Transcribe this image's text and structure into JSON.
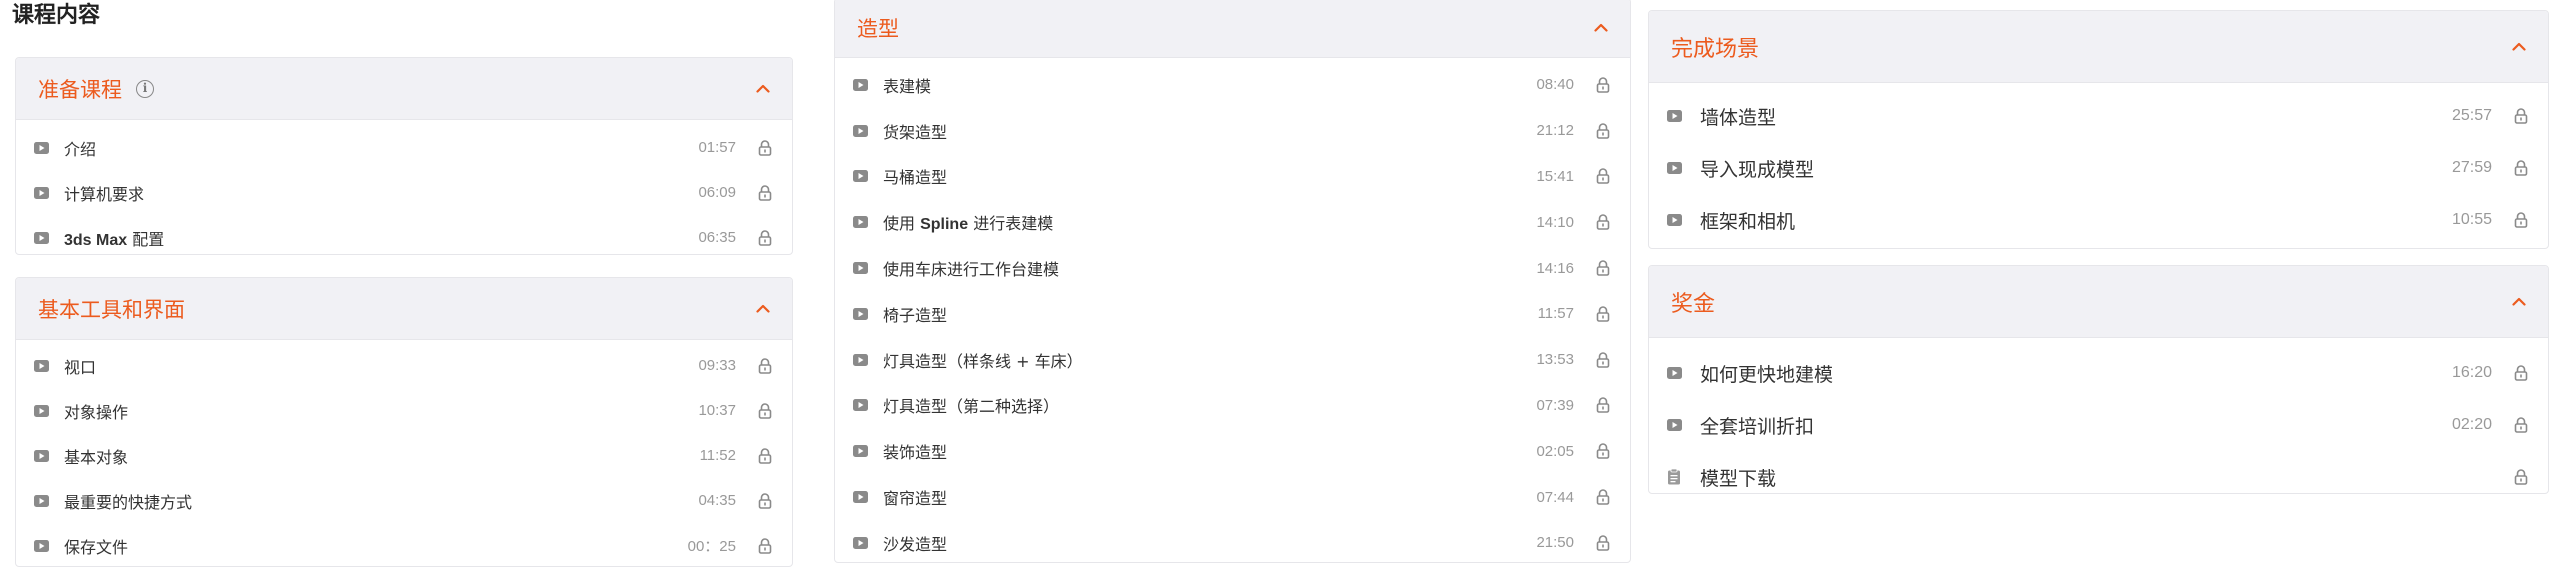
{
  "page_title": "课程内容",
  "columns": [
    {
      "sections": [
        {
          "title": "准备课程",
          "has_info": true,
          "info_glyph": "i",
          "items": [
            {
              "icon": "play-icon",
              "label": "介绍",
              "time": "01:57"
            },
            {
              "icon": "play-icon",
              "label_bold": "3ds Max",
              "label": " 配置",
              "time": "06:35",
              "skip": true
            },
            {
              "icon": "play-icon",
              "label": "计算机要求",
              "time": "06:09"
            }
          ]
        }
      ]
    }
  ],
  "col1": {
    "s1": {
      "title": "准备课程",
      "info_glyph": "i",
      "items": [
        {
          "label": "介绍",
          "time": "01:57"
        },
        {
          "label": "计算机要求",
          "time": "06:09"
        },
        {
          "label_bold": "3ds Max",
          "label": " 配置",
          "time": "06:35"
        }
      ]
    },
    "s2": {
      "title": "基本工具和界面",
      "items": [
        {
          "label": "视口",
          "time": "09:33"
        },
        {
          "label": "对象操作",
          "time": "10:37"
        },
        {
          "label": "基本对象",
          "time": "11:52"
        },
        {
          "label": "最重要的快捷方式",
          "time": "04:35"
        },
        {
          "label": "保存文件",
          "time": "00：25"
        }
      ]
    }
  },
  "col2": {
    "s1": {
      "title": "造型",
      "items": [
        {
          "pre": "表建模",
          "bold": "",
          "post": "",
          "time": "08:40"
        },
        {
          "pre": "货架造型",
          "bold": "",
          "post": "",
          "time": "21:12"
        },
        {
          "pre": "马桶造型",
          "bold": "",
          "post": "",
          "time": "15:41"
        },
        {
          "pre": "使用 ",
          "bold": "Spline",
          "post": " 进行表建模",
          "time": "14:10"
        },
        {
          "pre": "使用车床进行工作台建模",
          "bold": "",
          "post": "",
          "time": "14:16"
        },
        {
          "pre": "椅子造型",
          "bold": "",
          "post": "",
          "time": "11:57"
        },
        {
          "pre": "灯具造型（样条线 + 车床）",
          "bold": "",
          "post": "",
          "time": "13:53"
        },
        {
          "pre": "灯具造型（第二种选择）",
          "bold": "",
          "post": "",
          "time": "07:39"
        },
        {
          "pre": "装饰造型",
          "bold": "",
          "post": "",
          "time": "02:05"
        },
        {
          "pre": "窗帘造型",
          "bold": "",
          "post": "",
          "time": "07:44"
        },
        {
          "pre": "沙发造型",
          "bold": "",
          "post": "",
          "time": "21:50"
        }
      ]
    }
  },
  "col3": {
    "s1": {
      "title": "完成场景",
      "items": [
        {
          "label": "墙体造型",
          "time": "25:57"
        },
        {
          "label": "导入现成模型",
          "time": "27:59"
        },
        {
          "label": "框架和相机",
          "time": "10:55"
        }
      ]
    },
    "s2": {
      "title": "奖金",
      "items": [
        {
          "label": "如何更快地建模",
          "time": "16:20",
          "icon": "play-icon"
        },
        {
          "label": "全套培训折扣",
          "time": "02:20",
          "icon": "play-icon"
        },
        {
          "label": "模型下载",
          "time": "",
          "icon": "document-icon"
        }
      ]
    }
  },
  "colors": {
    "accent": "#ec5b1e",
    "header_bg": "#f1f1f5",
    "border": "#e6e6ea",
    "muted": "#999999"
  }
}
